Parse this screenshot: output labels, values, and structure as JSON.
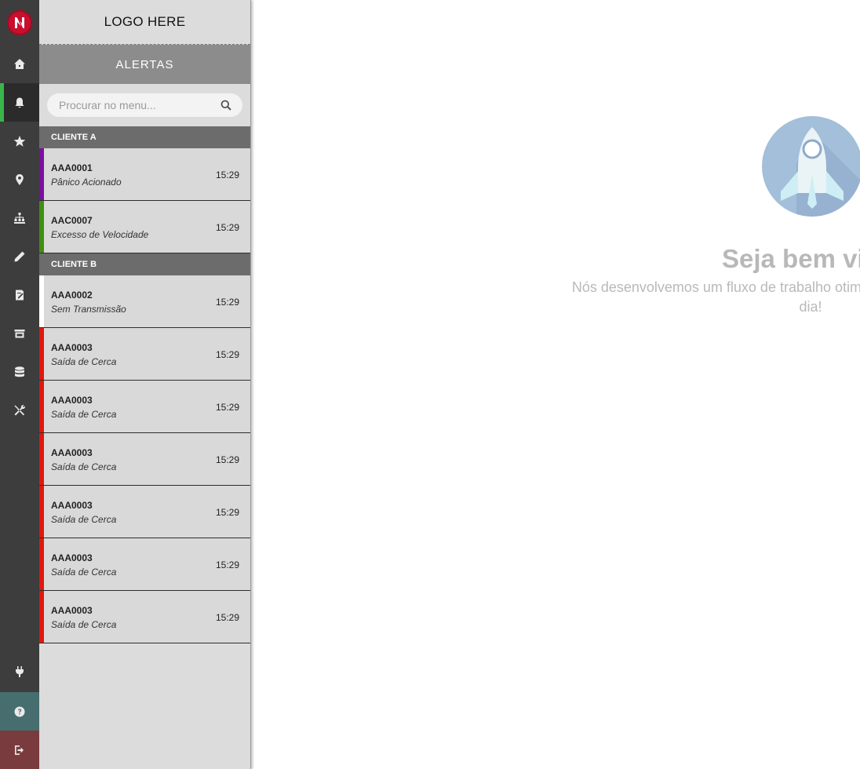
{
  "brand": {
    "logo_letter": "N",
    "logo_text": "LOGO HERE",
    "accent": "#c8102e",
    "active_indicator": "#39b54a"
  },
  "rail": {
    "items": [
      {
        "icon": "home-icon"
      },
      {
        "icon": "bell-icon",
        "active": true
      },
      {
        "icon": "star-icon"
      },
      {
        "icon": "map-marker-icon"
      },
      {
        "icon": "sitemap-icon"
      },
      {
        "icon": "pencil-icon"
      },
      {
        "icon": "edit-document-icon"
      },
      {
        "icon": "store-icon"
      },
      {
        "icon": "database-icon"
      },
      {
        "icon": "tools-icon"
      }
    ],
    "bottom": [
      {
        "icon": "plug-icon"
      },
      {
        "icon": "help-icon"
      },
      {
        "icon": "logout-icon"
      }
    ]
  },
  "panel": {
    "title": "ALERTAS",
    "search_placeholder": "Procurar no menu...",
    "groups": [
      {
        "name": "CLIENTE A",
        "items": [
          {
            "code": "AAA0001",
            "description": "Pânico Acionado",
            "time": "15:29",
            "color": "#7b0fa0"
          },
          {
            "code": "AAC0007",
            "description": "Excesso de Velocidade",
            "time": "15:29",
            "color": "#3f8f12"
          }
        ]
      },
      {
        "name": "CLIENTE B",
        "items": [
          {
            "code": "AAA0002",
            "description": "Sem Transmissão",
            "time": "15:29",
            "color": "#ffffff"
          },
          {
            "code": "AAA0003",
            "description": "Saída de Cerca",
            "time": "15:29",
            "color": "#e0180c"
          },
          {
            "code": "AAA0003",
            "description": "Saída de Cerca",
            "time": "15:29",
            "color": "#e0180c"
          },
          {
            "code": "AAA0003",
            "description": "Saída de Cerca",
            "time": "15:29",
            "color": "#e0180c"
          },
          {
            "code": "AAA0003",
            "description": "Saída de Cerca",
            "time": "15:29",
            "color": "#e0180c"
          },
          {
            "code": "AAA0003",
            "description": "Saída de Cerca",
            "time": "15:29",
            "color": "#e0180c"
          },
          {
            "code": "AAA0003",
            "description": "Saída de Cerca",
            "time": "15:29",
            "color": "#e0180c"
          }
        ]
      }
    ]
  },
  "main": {
    "welcome": "Seja bem vindo",
    "subtext": "Nós desenvolvemos um fluxo de trabalho otimizado para facilitar o seu dia a dia!"
  }
}
